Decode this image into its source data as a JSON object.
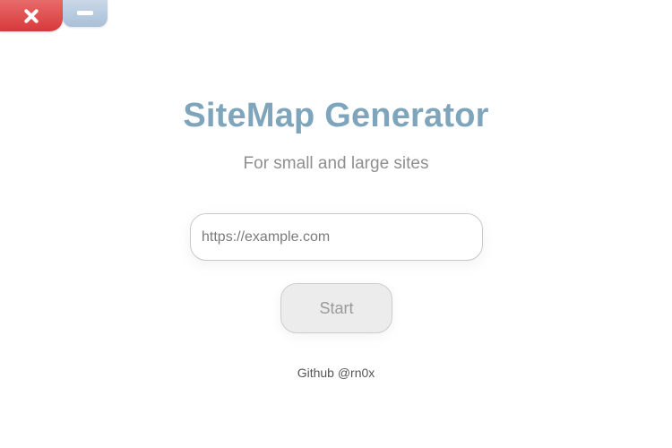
{
  "window": {
    "controls": {
      "close_icon": "close-icon",
      "minimize_icon": "minimize-icon",
      "close_color": "#d8393b",
      "minimize_color": "#a9c0d8"
    }
  },
  "header": {
    "title": "SiteMap Generator",
    "subtitle": "For small and large sites",
    "title_color": "#7ea5bb"
  },
  "form": {
    "url_input": {
      "value": "",
      "placeholder": "https://example.com"
    },
    "start_label": "Start"
  },
  "footer": {
    "link_text": "Github @rn0x"
  }
}
